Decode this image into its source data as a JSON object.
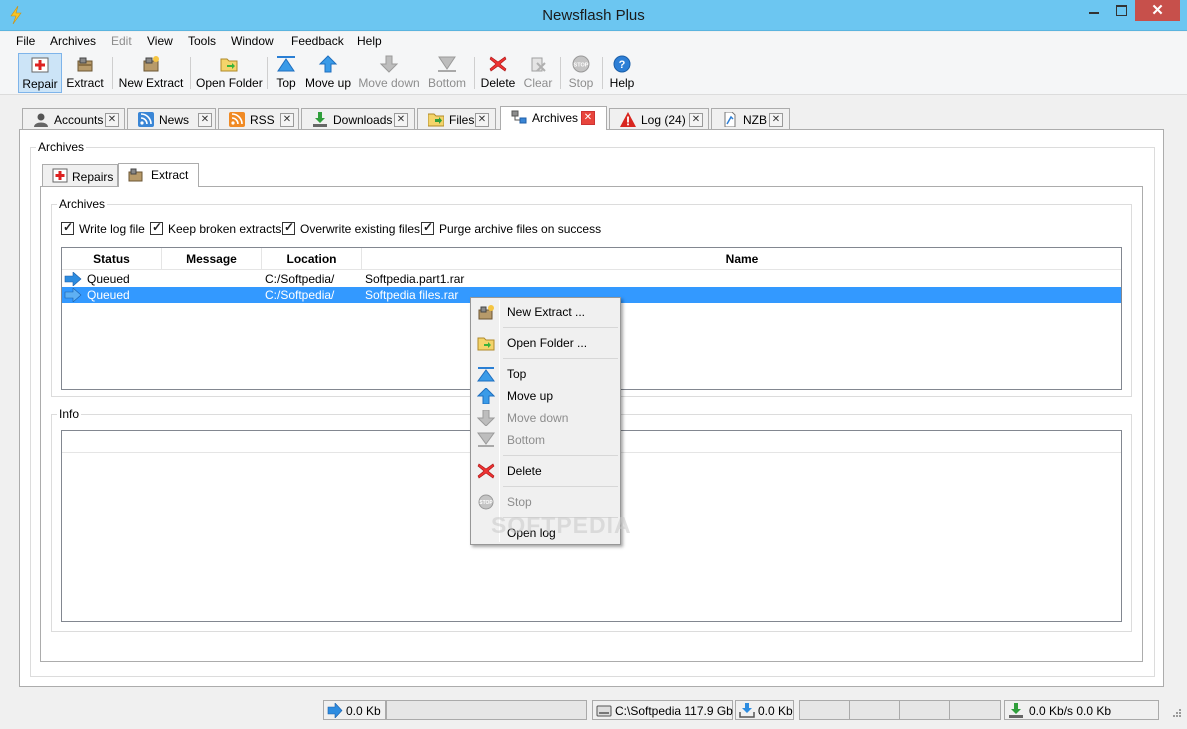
{
  "window": {
    "title": "Newsflash Plus",
    "close_glyph": "✕"
  },
  "menu": [
    "File",
    "Archives",
    "Edit",
    "View",
    "Tools",
    "Window",
    "Feedback",
    "Help"
  ],
  "toolbar": {
    "repair": "Repair",
    "extract": "Extract",
    "new_extract": "New Extract",
    "open_folder": "Open Folder",
    "top": "Top",
    "move_up": "Move up",
    "move_down": "Move down",
    "bottom": "Bottom",
    "delete": "Delete",
    "clear": "Clear",
    "stop": "Stop",
    "help": "Help"
  },
  "tabs": [
    "Accounts",
    "News",
    "RSS",
    "Downloads",
    "Files",
    "Archives",
    "Log (24)",
    "NZB"
  ],
  "tab_close_glyph": "✕",
  "archives_group": "Archives",
  "inner_tabs": {
    "repairs": "Repairs",
    "extract": "Extract"
  },
  "extract_group": "Archives",
  "options": {
    "write_log": "Write log file",
    "keep_broken": "Keep broken extracts",
    "overwrite": "Overwrite existing files",
    "purge": "Purge archive files on success"
  },
  "columns": {
    "status": "Status",
    "message": "Message",
    "location": "Location",
    "name": "Name"
  },
  "rows": [
    {
      "status": "Queued",
      "message": "",
      "location": "C:/Softpedia/",
      "name": "Softpedia.part1.rar"
    },
    {
      "status": "Queued",
      "message": "",
      "location": "C:/Softpedia/",
      "name": "Softpedia files.rar"
    }
  ],
  "info_group": "Info",
  "context_menu": {
    "new_extract": "New Extract ...",
    "open_folder": "Open Folder ...",
    "top": "Top",
    "move_up": "Move up",
    "move_down": "Move down",
    "bottom": "Bottom",
    "delete": "Delete",
    "stop": "Stop",
    "open_log": "Open log"
  },
  "watermark": "SOFTPEDIA",
  "statusbar": {
    "upload": "0.0 Kb",
    "disk": "C:\\Softpedia 117.9 Gb",
    "download": "0.0 Kb",
    "speed": "0.0 Kb/s 0.0 Kb"
  },
  "colors": {
    "titlebar": "#6cc6f1",
    "close": "#c7504b",
    "selection": "#3399ff",
    "tab_close_active": "#e8453c"
  }
}
